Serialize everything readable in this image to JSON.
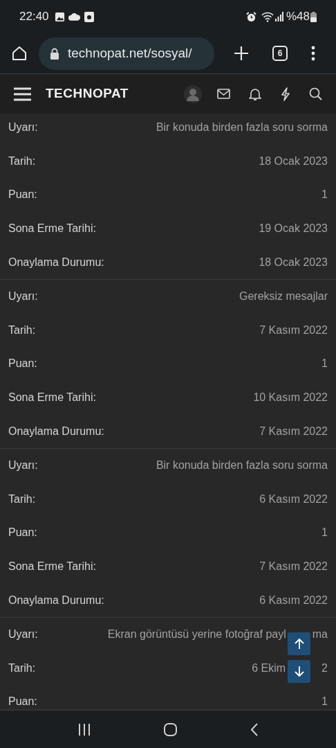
{
  "status_bar": {
    "time": "22:40",
    "battery": "%48"
  },
  "browser": {
    "url": "technopat.net/sosyal/",
    "tab_count": "6"
  },
  "site_header": {
    "logo": "TECHNOPAT"
  },
  "warnings": [
    {
      "rows": [
        {
          "label": "Uyarı:",
          "value": "Bir konuda birden fazla soru sorma"
        },
        {
          "label": "Tarih:",
          "value": "18 Ocak 2023"
        },
        {
          "label": "Puan:",
          "value": "1"
        },
        {
          "label": "Sona Erme Tarihi:",
          "value": "19 Ocak 2023"
        },
        {
          "label": "Onaylama Durumu:",
          "value": "18 Ocak 2023"
        }
      ]
    },
    {
      "rows": [
        {
          "label": "Uyarı:",
          "value": "Gereksiz mesajlar"
        },
        {
          "label": "Tarih:",
          "value": "7 Kasım 2022"
        },
        {
          "label": "Puan:",
          "value": "1"
        },
        {
          "label": "Sona Erme Tarihi:",
          "value": "10 Kasım 2022"
        },
        {
          "label": "Onaylama Durumu:",
          "value": "7 Kasım 2022"
        }
      ]
    },
    {
      "rows": [
        {
          "label": "Uyarı:",
          "value": "Bir konuda birden fazla soru sorma"
        },
        {
          "label": "Tarih:",
          "value": "6 Kasım 2022"
        },
        {
          "label": "Puan:",
          "value": "1"
        },
        {
          "label": "Sona Erme Tarihi:",
          "value": "7 Kasım 2022"
        },
        {
          "label": "Onaylama Durumu:",
          "value": "6 Kasım 2022"
        }
      ]
    },
    {
      "rows": [
        {
          "label": "Uyarı:",
          "value": "Ekran görüntüsü yerine fotoğraf payl",
          "tail": "ma"
        },
        {
          "label": "Tarih:",
          "value": "6 Ekim",
          "tail": "2"
        },
        {
          "label": "Puan:",
          "value": "1"
        }
      ]
    }
  ]
}
